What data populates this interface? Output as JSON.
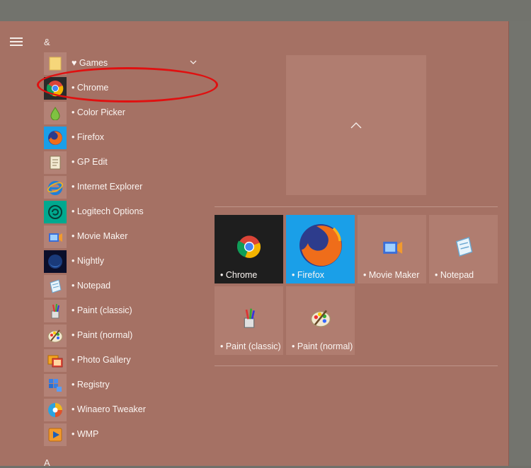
{
  "colors": {
    "panel": "#a57164",
    "tile": "#b07d70",
    "chrome_tile": "#1e1e1e",
    "firefox_tile": "#1a9fe8",
    "highlight_ellipse": "#e01010"
  },
  "sections": {
    "ampersand": "&",
    "a": "A"
  },
  "app_list": [
    {
      "label": "♥ Games",
      "icon": "folder-icon",
      "expandable": true
    },
    {
      "label": "• Chrome",
      "icon": "chrome-icon"
    },
    {
      "label": "• Color Picker",
      "icon": "color-picker-icon"
    },
    {
      "label": "• Firefox",
      "icon": "firefox-icon"
    },
    {
      "label": "• GP Edit",
      "icon": "gpedit-icon"
    },
    {
      "label": "• Internet Explorer",
      "icon": "internet-explorer-icon"
    },
    {
      "label": "• Logitech Options",
      "icon": "logitech-icon"
    },
    {
      "label": "• Movie Maker",
      "icon": "movie-maker-icon"
    },
    {
      "label": "• Nightly",
      "icon": "nightly-icon"
    },
    {
      "label": "• Notepad",
      "icon": "notepad-icon"
    },
    {
      "label": "• Paint (classic)",
      "icon": "paint-classic-icon"
    },
    {
      "label": "• Paint (normal)",
      "icon": "paint-normal-icon"
    },
    {
      "label": "• Photo Gallery",
      "icon": "photo-gallery-icon"
    },
    {
      "label": "• Registry",
      "icon": "registry-icon"
    },
    {
      "label": "• Winaero Tweaker",
      "icon": "winaero-icon"
    },
    {
      "label": "• WMP",
      "icon": "wmp-icon"
    }
  ],
  "tiles": [
    {
      "label": "• Chrome",
      "icon": "chrome-icon"
    },
    {
      "label": "• Firefox",
      "icon": "firefox-icon"
    },
    {
      "label": "• Movie Maker",
      "icon": "movie-maker-icon"
    },
    {
      "label": "• Notepad",
      "icon": "notepad-icon"
    },
    {
      "label": "• Paint (classic)",
      "icon": "paint-classic-icon"
    },
    {
      "label": "• Paint (normal)",
      "icon": "paint-normal-icon"
    }
  ],
  "collapse_tile_icon": "chevron-up-icon"
}
